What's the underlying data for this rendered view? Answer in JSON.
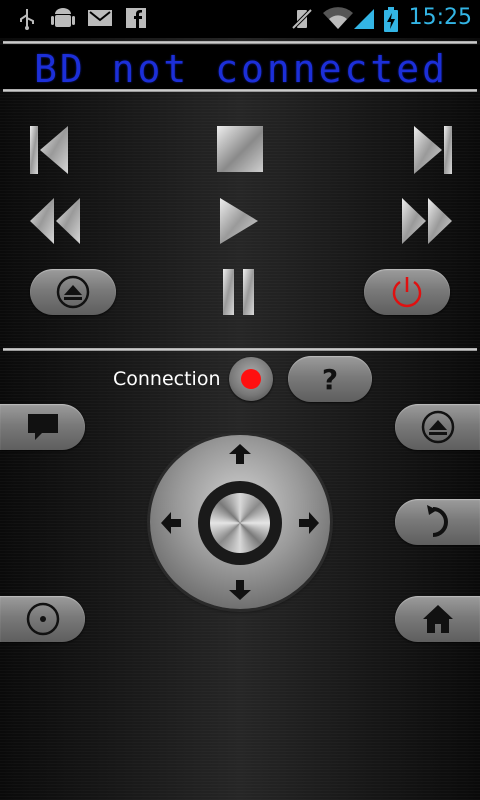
{
  "status_bar": {
    "time": "15:25",
    "left_icons": [
      "usb-icon",
      "android-debug-icon",
      "gmail-icon",
      "facebook-icon"
    ],
    "right_icons": [
      "vibrate-off-icon",
      "wifi-icon",
      "signal-icon",
      "battery-charging-icon"
    ]
  },
  "display": {
    "text": "BD not connected",
    "color": "#1c2fd8"
  },
  "transport": [
    "previous-track-icon",
    "stop-icon",
    "next-track-icon",
    "rewind-icon",
    "play-icon",
    "fast-forward-icon",
    "eject-icon",
    "pause-icon",
    "power-icon"
  ],
  "connection": {
    "label": "Connection",
    "status_color": "#ff1010",
    "help_label": "?"
  },
  "remote_buttons": [
    "subtitle-icon",
    "top-menu-icon",
    "return-icon",
    "disc-icon",
    "home-icon"
  ],
  "dpad": [
    "up-arrow-icon",
    "left-arrow-icon",
    "right-arrow-icon",
    "down-arrow-icon",
    "enter-icon"
  ],
  "colors": {
    "accent_blue": "#33b5e5",
    "power_red": "#e01010"
  }
}
